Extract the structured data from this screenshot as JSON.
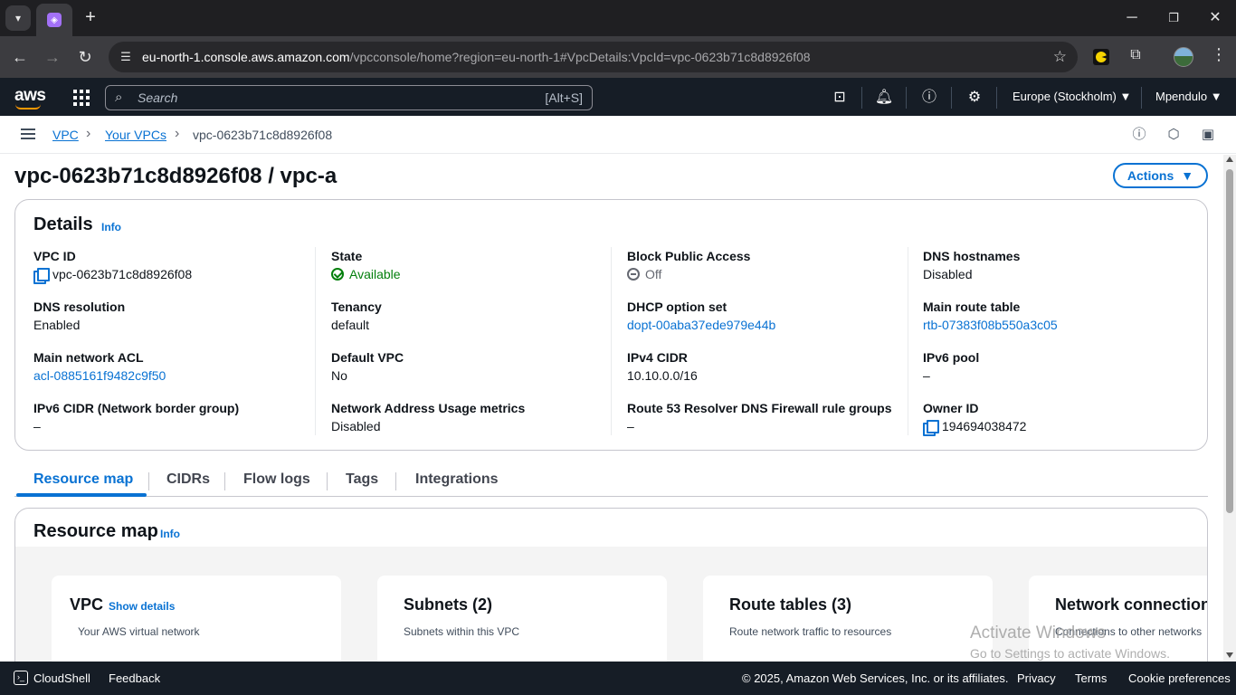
{
  "browser": {
    "url_host": "eu-north-1.console.aws.amazon.com",
    "url_path": "/vpcconsole/home?region=eu-north-1#VpcDetails:VpcId=vpc-0623b71c8d8926f08"
  },
  "aws_nav": {
    "logo": "aws",
    "search_placeholder": "Search",
    "search_shortcut": "[Alt+S]",
    "region": "Europe (Stockholm)",
    "user": "Mpendulo"
  },
  "breadcrumb": {
    "items": [
      "VPC",
      "Your VPCs"
    ],
    "current": "vpc-0623b71c8d8926f08"
  },
  "page": {
    "title": "vpc-0623b71c8d8926f08 / vpc-a",
    "actions_label": "Actions"
  },
  "details": {
    "title": "Details",
    "info": "Info",
    "columns": [
      [
        {
          "label": "VPC ID",
          "value": "vpc-0623b71c8d8926f08",
          "icon": "copy-icon"
        },
        {
          "label": "DNS resolution",
          "value": "Enabled"
        },
        {
          "label": "Main network ACL",
          "value": "acl-0885161f9482c9f50",
          "link": true
        },
        {
          "label": "IPv6 CIDR (Network border group)",
          "value": "–"
        }
      ],
      [
        {
          "label": "State",
          "value": "Available",
          "icon": "check-circle-icon"
        },
        {
          "label": "Tenancy",
          "value": "default"
        },
        {
          "label": "Default VPC",
          "value": "No"
        },
        {
          "label": "Network Address Usage metrics",
          "value": "Disabled"
        }
      ],
      [
        {
          "label": "Block Public Access",
          "value": "Off",
          "icon": "off-icon"
        },
        {
          "label": "DHCP option set",
          "value": "dopt-00aba37ede979e44b",
          "link": true
        },
        {
          "label": "IPv4 CIDR",
          "value": "10.10.0.0/16"
        },
        {
          "label": "Route 53 Resolver DNS Firewall rule groups",
          "value": "–"
        }
      ],
      [
        {
          "label": "DNS hostnames",
          "value": "Disabled"
        },
        {
          "label": "Main route table",
          "value": "rtb-07383f08b550a3c05",
          "link": true
        },
        {
          "label": "IPv6 pool",
          "value": "–"
        },
        {
          "label": "Owner ID",
          "value": "194694038472",
          "icon": "copy-icon"
        }
      ]
    ]
  },
  "tabs": [
    "Resource map",
    "CIDRs",
    "Flow logs",
    "Tags",
    "Integrations"
  ],
  "resource_map": {
    "title": "Resource map",
    "info": "Info",
    "cards": [
      {
        "title": "VPC",
        "action": "Show details",
        "subtitle": "Your AWS virtual network"
      },
      {
        "title": "Subnets (2)",
        "subtitle": "Subnets within this VPC"
      },
      {
        "title": "Route tables (3)",
        "subtitle": "Route network traffic to resources"
      },
      {
        "title": "Network connection",
        "subtitle": "Connections to other networks"
      }
    ]
  },
  "watermark": {
    "line1": "Activate Windows",
    "line2": "Go to Settings to activate Windows."
  },
  "footer": {
    "cloudshell": "CloudShell",
    "feedback": "Feedback",
    "copyright": "© 2025, Amazon Web Services, Inc. or its affiliates.",
    "privacy": "Privacy",
    "terms": "Terms",
    "cookies": "Cookie preferences"
  }
}
